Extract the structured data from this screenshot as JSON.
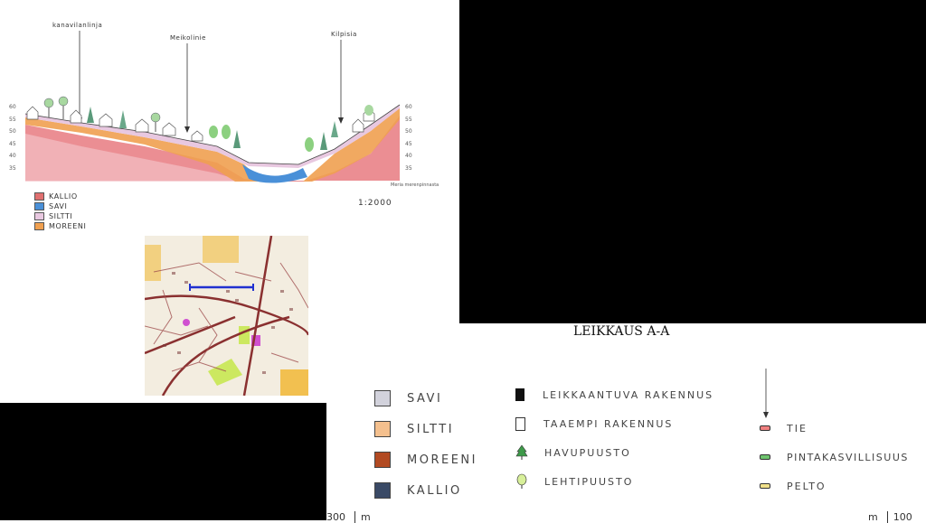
{
  "section_top": {
    "callouts": [
      "kanavilanlinja",
      "Meikolinie",
      "Kilpisia"
    ],
    "scale": "1:2000",
    "footnote": "Meria merenpinnasta",
    "axis_left": [
      "60",
      "55",
      "50",
      "45",
      "40",
      "35"
    ],
    "axis_right": [
      "60",
      "55",
      "50",
      "45",
      "40",
      "35"
    ],
    "legend": [
      {
        "label": "KALLIO",
        "color": "#e07070"
      },
      {
        "label": "SAVI",
        "color": "#4a90d8"
      },
      {
        "label": "SILTTI",
        "color": "#e8c8e0"
      },
      {
        "label": "MOREENI",
        "color": "#f0a050"
      }
    ]
  },
  "title": "LEIKKAUS A-A",
  "legend_main": {
    "col1": [
      {
        "label": "SAVI",
        "color": "#d2d2dc"
      },
      {
        "label": "SILTTI",
        "color": "#f4c08e"
      },
      {
        "label": "MOREENI",
        "color": "#b24a22"
      },
      {
        "label": "KALLIO",
        "color": "#3a4a66"
      }
    ],
    "col2": [
      {
        "label": "LEIKKAANTUVA RAKENNUS"
      },
      {
        "label": "TAAEMPI RAKENNUS"
      },
      {
        "label": "HAVUPUUSTO"
      },
      {
        "label": "LEHTIPUUSTO"
      }
    ],
    "col3": [
      {
        "label": "TIE",
        "color": "#f08080"
      },
      {
        "label": "PINTAKASVILLISUUS",
        "color": "#6ec46e"
      },
      {
        "label": "PELTO",
        "color": "#f0e08a"
      }
    ]
  },
  "scale_bar": {
    "left": "300",
    "unit": "m",
    "right_unit": "m",
    "right": "100"
  }
}
